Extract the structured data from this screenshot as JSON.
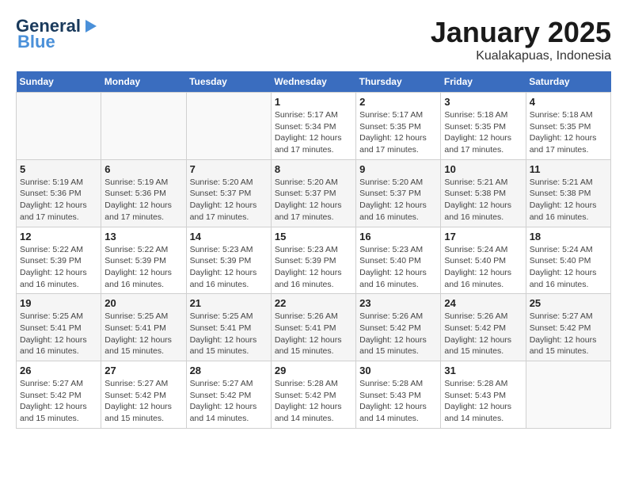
{
  "header": {
    "logo_line1": "General",
    "logo_line2": "Blue",
    "title": "January 2025",
    "subtitle": "Kualakapuas, Indonesia"
  },
  "weekdays": [
    "Sunday",
    "Monday",
    "Tuesday",
    "Wednesday",
    "Thursday",
    "Friday",
    "Saturday"
  ],
  "weeks": [
    [
      {
        "day": "",
        "sunrise": "",
        "sunset": "",
        "daylight": ""
      },
      {
        "day": "",
        "sunrise": "",
        "sunset": "",
        "daylight": ""
      },
      {
        "day": "",
        "sunrise": "",
        "sunset": "",
        "daylight": ""
      },
      {
        "day": "1",
        "sunrise": "Sunrise: 5:17 AM",
        "sunset": "Sunset: 5:34 PM",
        "daylight": "Daylight: 12 hours and 17 minutes."
      },
      {
        "day": "2",
        "sunrise": "Sunrise: 5:17 AM",
        "sunset": "Sunset: 5:35 PM",
        "daylight": "Daylight: 12 hours and 17 minutes."
      },
      {
        "day": "3",
        "sunrise": "Sunrise: 5:18 AM",
        "sunset": "Sunset: 5:35 PM",
        "daylight": "Daylight: 12 hours and 17 minutes."
      },
      {
        "day": "4",
        "sunrise": "Sunrise: 5:18 AM",
        "sunset": "Sunset: 5:35 PM",
        "daylight": "Daylight: 12 hours and 17 minutes."
      }
    ],
    [
      {
        "day": "5",
        "sunrise": "Sunrise: 5:19 AM",
        "sunset": "Sunset: 5:36 PM",
        "daylight": "Daylight: 12 hours and 17 minutes."
      },
      {
        "day": "6",
        "sunrise": "Sunrise: 5:19 AM",
        "sunset": "Sunset: 5:36 PM",
        "daylight": "Daylight: 12 hours and 17 minutes."
      },
      {
        "day": "7",
        "sunrise": "Sunrise: 5:20 AM",
        "sunset": "Sunset: 5:37 PM",
        "daylight": "Daylight: 12 hours and 17 minutes."
      },
      {
        "day": "8",
        "sunrise": "Sunrise: 5:20 AM",
        "sunset": "Sunset: 5:37 PM",
        "daylight": "Daylight: 12 hours and 17 minutes."
      },
      {
        "day": "9",
        "sunrise": "Sunrise: 5:20 AM",
        "sunset": "Sunset: 5:37 PM",
        "daylight": "Daylight: 12 hours and 16 minutes."
      },
      {
        "day": "10",
        "sunrise": "Sunrise: 5:21 AM",
        "sunset": "Sunset: 5:38 PM",
        "daylight": "Daylight: 12 hours and 16 minutes."
      },
      {
        "day": "11",
        "sunrise": "Sunrise: 5:21 AM",
        "sunset": "Sunset: 5:38 PM",
        "daylight": "Daylight: 12 hours and 16 minutes."
      }
    ],
    [
      {
        "day": "12",
        "sunrise": "Sunrise: 5:22 AM",
        "sunset": "Sunset: 5:39 PM",
        "daylight": "Daylight: 12 hours and 16 minutes."
      },
      {
        "day": "13",
        "sunrise": "Sunrise: 5:22 AM",
        "sunset": "Sunset: 5:39 PM",
        "daylight": "Daylight: 12 hours and 16 minutes."
      },
      {
        "day": "14",
        "sunrise": "Sunrise: 5:23 AM",
        "sunset": "Sunset: 5:39 PM",
        "daylight": "Daylight: 12 hours and 16 minutes."
      },
      {
        "day": "15",
        "sunrise": "Sunrise: 5:23 AM",
        "sunset": "Sunset: 5:39 PM",
        "daylight": "Daylight: 12 hours and 16 minutes."
      },
      {
        "day": "16",
        "sunrise": "Sunrise: 5:23 AM",
        "sunset": "Sunset: 5:40 PM",
        "daylight": "Daylight: 12 hours and 16 minutes."
      },
      {
        "day": "17",
        "sunrise": "Sunrise: 5:24 AM",
        "sunset": "Sunset: 5:40 PM",
        "daylight": "Daylight: 12 hours and 16 minutes."
      },
      {
        "day": "18",
        "sunrise": "Sunrise: 5:24 AM",
        "sunset": "Sunset: 5:40 PM",
        "daylight": "Daylight: 12 hours and 16 minutes."
      }
    ],
    [
      {
        "day": "19",
        "sunrise": "Sunrise: 5:25 AM",
        "sunset": "Sunset: 5:41 PM",
        "daylight": "Daylight: 12 hours and 16 minutes."
      },
      {
        "day": "20",
        "sunrise": "Sunrise: 5:25 AM",
        "sunset": "Sunset: 5:41 PM",
        "daylight": "Daylight: 12 hours and 15 minutes."
      },
      {
        "day": "21",
        "sunrise": "Sunrise: 5:25 AM",
        "sunset": "Sunset: 5:41 PM",
        "daylight": "Daylight: 12 hours and 15 minutes."
      },
      {
        "day": "22",
        "sunrise": "Sunrise: 5:26 AM",
        "sunset": "Sunset: 5:41 PM",
        "daylight": "Daylight: 12 hours and 15 minutes."
      },
      {
        "day": "23",
        "sunrise": "Sunrise: 5:26 AM",
        "sunset": "Sunset: 5:42 PM",
        "daylight": "Daylight: 12 hours and 15 minutes."
      },
      {
        "day": "24",
        "sunrise": "Sunrise: 5:26 AM",
        "sunset": "Sunset: 5:42 PM",
        "daylight": "Daylight: 12 hours and 15 minutes."
      },
      {
        "day": "25",
        "sunrise": "Sunrise: 5:27 AM",
        "sunset": "Sunset: 5:42 PM",
        "daylight": "Daylight: 12 hours and 15 minutes."
      }
    ],
    [
      {
        "day": "26",
        "sunrise": "Sunrise: 5:27 AM",
        "sunset": "Sunset: 5:42 PM",
        "daylight": "Daylight: 12 hours and 15 minutes."
      },
      {
        "day": "27",
        "sunrise": "Sunrise: 5:27 AM",
        "sunset": "Sunset: 5:42 PM",
        "daylight": "Daylight: 12 hours and 15 minutes."
      },
      {
        "day": "28",
        "sunrise": "Sunrise: 5:27 AM",
        "sunset": "Sunset: 5:42 PM",
        "daylight": "Daylight: 12 hours and 14 minutes."
      },
      {
        "day": "29",
        "sunrise": "Sunrise: 5:28 AM",
        "sunset": "Sunset: 5:42 PM",
        "daylight": "Daylight: 12 hours and 14 minutes."
      },
      {
        "day": "30",
        "sunrise": "Sunrise: 5:28 AM",
        "sunset": "Sunset: 5:43 PM",
        "daylight": "Daylight: 12 hours and 14 minutes."
      },
      {
        "day": "31",
        "sunrise": "Sunrise: 5:28 AM",
        "sunset": "Sunset: 5:43 PM",
        "daylight": "Daylight: 12 hours and 14 minutes."
      },
      {
        "day": "",
        "sunrise": "",
        "sunset": "",
        "daylight": ""
      }
    ]
  ]
}
